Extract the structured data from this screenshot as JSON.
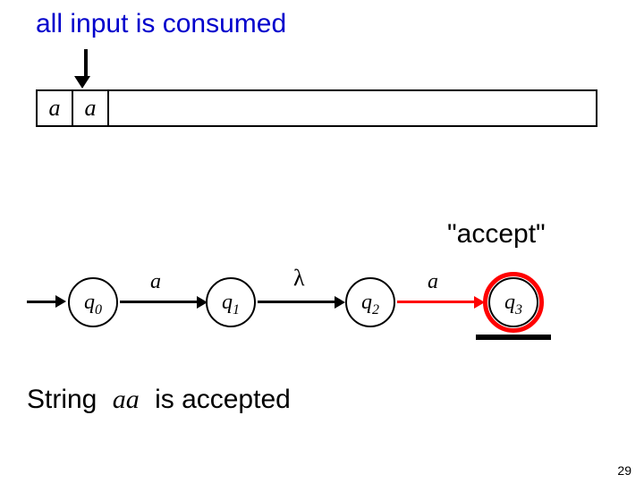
{
  "title": "all input is consumed",
  "tape": {
    "cells": [
      "a",
      "a"
    ]
  },
  "accept_label": "\"accept\"",
  "states": {
    "q0": {
      "name": "q",
      "sub": "0"
    },
    "q1": {
      "name": "q",
      "sub": "1"
    },
    "q2": {
      "name": "q",
      "sub": "2"
    },
    "q3": {
      "name": "q",
      "sub": "3"
    }
  },
  "transitions": {
    "t01": "a",
    "t12": "λ",
    "t23": "a"
  },
  "conclusion": {
    "prefix": "String",
    "string": "aa",
    "suffix": "is accepted"
  },
  "slide_number": "29"
}
